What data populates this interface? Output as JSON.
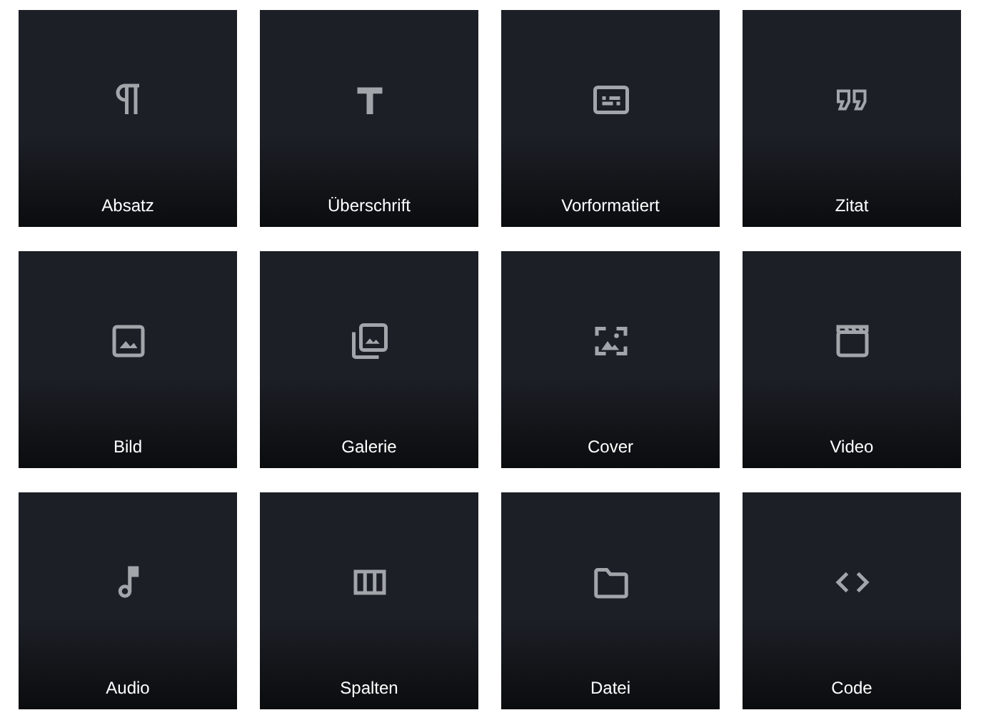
{
  "blocks": [
    {
      "label": "Absatz",
      "kind": "paragraph"
    },
    {
      "label": "Überschrift",
      "kind": "heading"
    },
    {
      "label": "Vorformatiert",
      "kind": "preformatted"
    },
    {
      "label": "Zitat",
      "kind": "quote"
    },
    {
      "label": "Bild",
      "kind": "image"
    },
    {
      "label": "Galerie",
      "kind": "gallery"
    },
    {
      "label": "Cover",
      "kind": "cover"
    },
    {
      "label": "Video",
      "kind": "video"
    },
    {
      "label": "Audio",
      "kind": "audio"
    },
    {
      "label": "Spalten",
      "kind": "columns"
    },
    {
      "label": "Datei",
      "kind": "file"
    },
    {
      "label": "Code",
      "kind": "code"
    }
  ]
}
